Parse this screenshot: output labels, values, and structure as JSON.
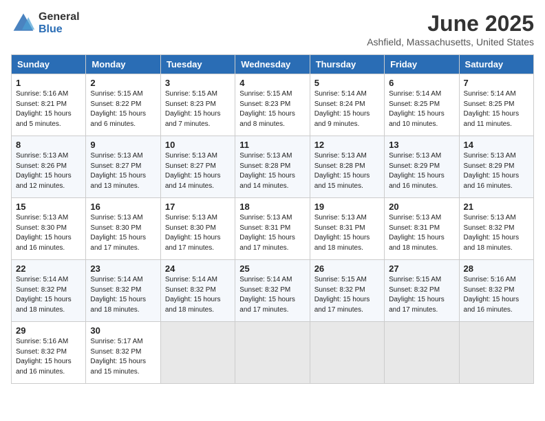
{
  "header": {
    "logo": {
      "general": "General",
      "blue": "Blue"
    },
    "title": "June 2025",
    "location": "Ashfield, Massachusetts, United States"
  },
  "days_of_week": [
    "Sunday",
    "Monday",
    "Tuesday",
    "Wednesday",
    "Thursday",
    "Friday",
    "Saturday"
  ],
  "weeks": [
    [
      {
        "day": 1,
        "sunrise": "5:16 AM",
        "sunset": "8:21 PM",
        "daylight": "15 hours and 5 minutes."
      },
      {
        "day": 2,
        "sunrise": "5:15 AM",
        "sunset": "8:22 PM",
        "daylight": "15 hours and 6 minutes."
      },
      {
        "day": 3,
        "sunrise": "5:15 AM",
        "sunset": "8:23 PM",
        "daylight": "15 hours and 7 minutes."
      },
      {
        "day": 4,
        "sunrise": "5:15 AM",
        "sunset": "8:23 PM",
        "daylight": "15 hours and 8 minutes."
      },
      {
        "day": 5,
        "sunrise": "5:14 AM",
        "sunset": "8:24 PM",
        "daylight": "15 hours and 9 minutes."
      },
      {
        "day": 6,
        "sunrise": "5:14 AM",
        "sunset": "8:25 PM",
        "daylight": "15 hours and 10 minutes."
      },
      {
        "day": 7,
        "sunrise": "5:14 AM",
        "sunset": "8:25 PM",
        "daylight": "15 hours and 11 minutes."
      }
    ],
    [
      {
        "day": 8,
        "sunrise": "5:13 AM",
        "sunset": "8:26 PM",
        "daylight": "15 hours and 12 minutes."
      },
      {
        "day": 9,
        "sunrise": "5:13 AM",
        "sunset": "8:27 PM",
        "daylight": "15 hours and 13 minutes."
      },
      {
        "day": 10,
        "sunrise": "5:13 AM",
        "sunset": "8:27 PM",
        "daylight": "15 hours and 14 minutes."
      },
      {
        "day": 11,
        "sunrise": "5:13 AM",
        "sunset": "8:28 PM",
        "daylight": "15 hours and 14 minutes."
      },
      {
        "day": 12,
        "sunrise": "5:13 AM",
        "sunset": "8:28 PM",
        "daylight": "15 hours and 15 minutes."
      },
      {
        "day": 13,
        "sunrise": "5:13 AM",
        "sunset": "8:29 PM",
        "daylight": "15 hours and 16 minutes."
      },
      {
        "day": 14,
        "sunrise": "5:13 AM",
        "sunset": "8:29 PM",
        "daylight": "15 hours and 16 minutes."
      }
    ],
    [
      {
        "day": 15,
        "sunrise": "5:13 AM",
        "sunset": "8:30 PM",
        "daylight": "15 hours and 16 minutes."
      },
      {
        "day": 16,
        "sunrise": "5:13 AM",
        "sunset": "8:30 PM",
        "daylight": "15 hours and 17 minutes."
      },
      {
        "day": 17,
        "sunrise": "5:13 AM",
        "sunset": "8:30 PM",
        "daylight": "15 hours and 17 minutes."
      },
      {
        "day": 18,
        "sunrise": "5:13 AM",
        "sunset": "8:31 PM",
        "daylight": "15 hours and 17 minutes."
      },
      {
        "day": 19,
        "sunrise": "5:13 AM",
        "sunset": "8:31 PM",
        "daylight": "15 hours and 18 minutes."
      },
      {
        "day": 20,
        "sunrise": "5:13 AM",
        "sunset": "8:31 PM",
        "daylight": "15 hours and 18 minutes."
      },
      {
        "day": 21,
        "sunrise": "5:13 AM",
        "sunset": "8:32 PM",
        "daylight": "15 hours and 18 minutes."
      }
    ],
    [
      {
        "day": 22,
        "sunrise": "5:14 AM",
        "sunset": "8:32 PM",
        "daylight": "15 hours and 18 minutes."
      },
      {
        "day": 23,
        "sunrise": "5:14 AM",
        "sunset": "8:32 PM",
        "daylight": "15 hours and 18 minutes."
      },
      {
        "day": 24,
        "sunrise": "5:14 AM",
        "sunset": "8:32 PM",
        "daylight": "15 hours and 18 minutes."
      },
      {
        "day": 25,
        "sunrise": "5:14 AM",
        "sunset": "8:32 PM",
        "daylight": "15 hours and 17 minutes."
      },
      {
        "day": 26,
        "sunrise": "5:15 AM",
        "sunset": "8:32 PM",
        "daylight": "15 hours and 17 minutes."
      },
      {
        "day": 27,
        "sunrise": "5:15 AM",
        "sunset": "8:32 PM",
        "daylight": "15 hours and 17 minutes."
      },
      {
        "day": 28,
        "sunrise": "5:16 AM",
        "sunset": "8:32 PM",
        "daylight": "15 hours and 16 minutes."
      }
    ],
    [
      {
        "day": 29,
        "sunrise": "5:16 AM",
        "sunset": "8:32 PM",
        "daylight": "15 hours and 16 minutes."
      },
      {
        "day": 30,
        "sunrise": "5:17 AM",
        "sunset": "8:32 PM",
        "daylight": "15 hours and 15 minutes."
      },
      null,
      null,
      null,
      null,
      null
    ]
  ]
}
